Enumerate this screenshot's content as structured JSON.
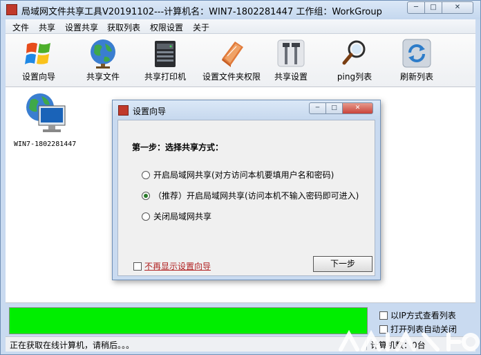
{
  "window": {
    "title": "局域网文件共享工具V20191102---计算机名：WIN7-1802281447  工作组：WorkGroup",
    "caption_min": "─",
    "caption_max": "□",
    "caption_close": "✕"
  },
  "menu": [
    "文件",
    "共享",
    "设置共享",
    "获取列表",
    "权限设置",
    "关于"
  ],
  "toolbar": [
    {
      "label": "设置向导",
      "icon": "windows-logo-icon"
    },
    {
      "label": "共享文件",
      "icon": "globe-icon"
    },
    {
      "label": "共享打印机",
      "icon": "printer-server-icon"
    },
    {
      "label": "设置文件夹权限",
      "icon": "book-icon"
    },
    {
      "label": "共享设置",
      "icon": "tools-icon"
    },
    {
      "label": "ping列表",
      "icon": "magnifier-icon"
    },
    {
      "label": "刷新列表",
      "icon": "refresh-icon"
    }
  ],
  "computer": {
    "name": "WIN7-1802281447"
  },
  "dialog": {
    "title": "设置向导",
    "step_title": "第一步：选择共享方式：",
    "options": [
      {
        "label": "开启局域网共享(对方访问本机要填用户名和密码)",
        "selected": false
      },
      {
        "label": "（推荐）开启局域网共享(访问本机不输入密码即可进入)",
        "selected": true
      },
      {
        "label": "关闭局域网共享",
        "selected": false
      }
    ],
    "dont_show_label": "不再显示设置向导",
    "next_button": "下一步"
  },
  "bottom": {
    "ip_view_label": "以IP方式查看列表",
    "open_list_label": "打开列表自动关闭"
  },
  "status": {
    "left": "正在获取在线计算机，请稍后。。。",
    "right": "计算机数：0台"
  },
  "colors": {
    "progress": "#00ee00",
    "frame": "#c9daf0"
  }
}
